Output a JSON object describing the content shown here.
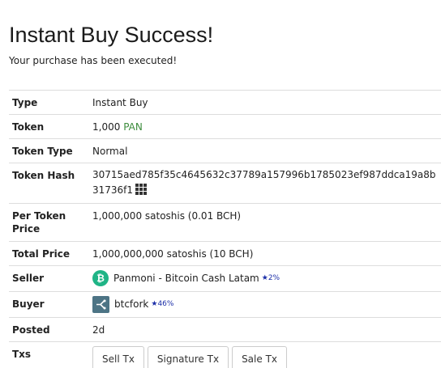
{
  "title": "Instant Buy Success!",
  "subtitle": "Your purchase has been executed!",
  "rows": {
    "type": {
      "label": "Type",
      "value": "Instant Buy"
    },
    "token": {
      "label": "Token",
      "amount": "1,000",
      "symbol": "PAN"
    },
    "token_type": {
      "label": "Token Type",
      "value": "Normal"
    },
    "token_hash": {
      "label": "Token Hash",
      "value": "30715aed785f35c4645632c37789a157996b1785023ef987ddca19a8b31736f1"
    },
    "per_token_price": {
      "label": "Per Token Price",
      "value": "1,000,000 satoshis (0.01 BCH)"
    },
    "total_price": {
      "label": "Total Price",
      "value": "1,000,000,000 satoshis (10 BCH)"
    },
    "seller": {
      "label": "Seller",
      "name": "Panmoni - Bitcoin Cash Latam",
      "rating": "★2%"
    },
    "buyer": {
      "label": "Buyer",
      "name": "btcfork",
      "rating": "★46%"
    },
    "posted": {
      "label": "Posted",
      "value": "2d"
    },
    "txs": {
      "label": "Txs",
      "buttons": [
        "Sell Tx",
        "Signature Tx",
        "Sale Tx"
      ]
    }
  },
  "icons": {
    "seller_logo": "bitcoin-cash-icon",
    "buyer_logo": "fork-icon",
    "hash_identicon": "grid-icon"
  },
  "colors": {
    "token_symbol": "#3c8c3c",
    "rating": "#1c2fa8",
    "bch_green": "#1fb486"
  }
}
